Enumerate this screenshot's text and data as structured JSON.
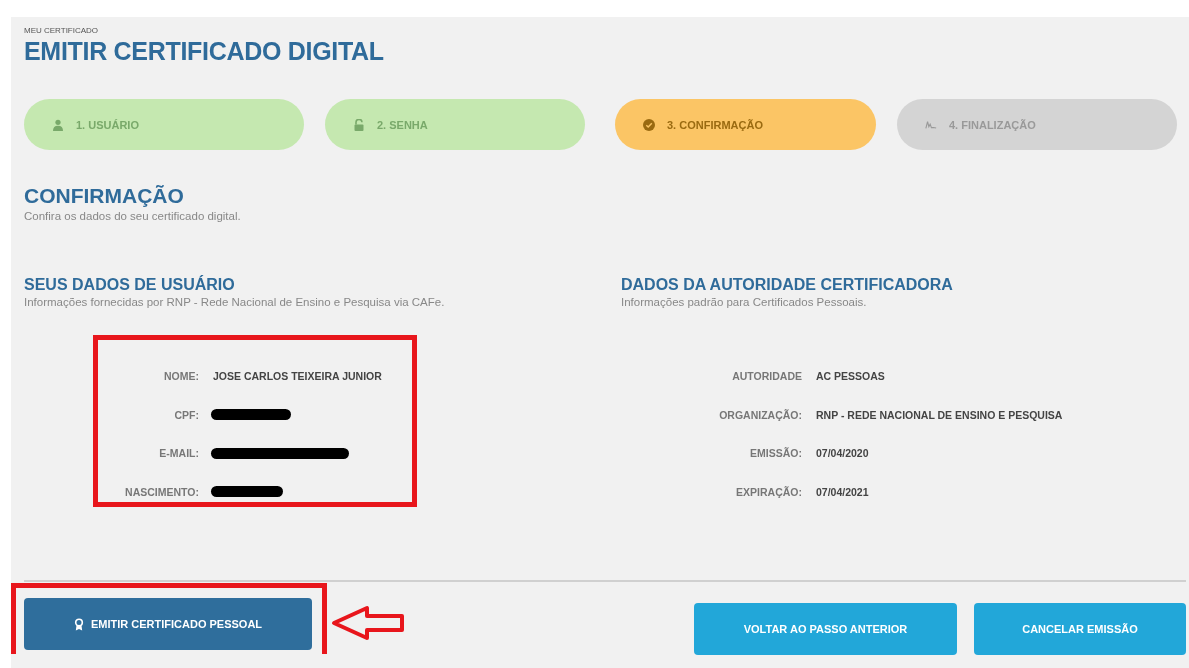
{
  "breadcrumb": "MEU CERTIFICADO",
  "title": "EMITIR CERTIFICADO DIGITAL",
  "steps": [
    {
      "label": "1. USUÁRIO",
      "kind": "done"
    },
    {
      "label": "2. SENHA",
      "kind": "done"
    },
    {
      "label": "3. CONFIRMAÇÃO",
      "kind": "current"
    },
    {
      "label": "4. FINALIZAÇÃO",
      "kind": "pending"
    }
  ],
  "section": {
    "title": "CONFIRMAÇÃO",
    "subtitle": "Confira os dados do seu certificado digital."
  },
  "user_data": {
    "title": "SEUS DADOS DE USUÁRIO",
    "subtitle": "Informações fornecidas por RNP - Rede Nacional de Ensino e Pesquisa via CAFe.",
    "highlighted": true,
    "fields": [
      {
        "label": "NOME:",
        "kind": "text",
        "value": "JOSE CARLOS TEIXEIRA JUNIOR"
      },
      {
        "label": "CPF:",
        "kind": "redacted"
      },
      {
        "label": "E-MAIL:",
        "kind": "redacted"
      },
      {
        "label": "NASCIMENTO:",
        "kind": "redacted"
      }
    ]
  },
  "authority_data": {
    "title": "DADOS DA AUTORIDADE CERTIFICADORA",
    "subtitle": "Informações padrão para Certificados Pessoais.",
    "fields": [
      {
        "label": "AUTORIDADE",
        "kind": "text",
        "value": "AC PESSOAS"
      },
      {
        "label": "ORGANIZAÇÃO:",
        "kind": "text",
        "value": "RNP - REDE NACIONAL DE ENSINO E PESQUISA"
      },
      {
        "label": "EMISSÃO:",
        "kind": "text",
        "value": "07/04/2020"
      },
      {
        "label": "EXPIRAÇÃO:",
        "kind": "text",
        "value": "07/04/2021"
      }
    ]
  },
  "actions": {
    "primary": {
      "label": "EMITIR CERTIFICADO PESSOAL",
      "highlighted": true
    },
    "secondary": [
      "VOLTAR AO PASSO ANTERIOR",
      "CANCELAR EMISSÃO"
    ]
  }
}
